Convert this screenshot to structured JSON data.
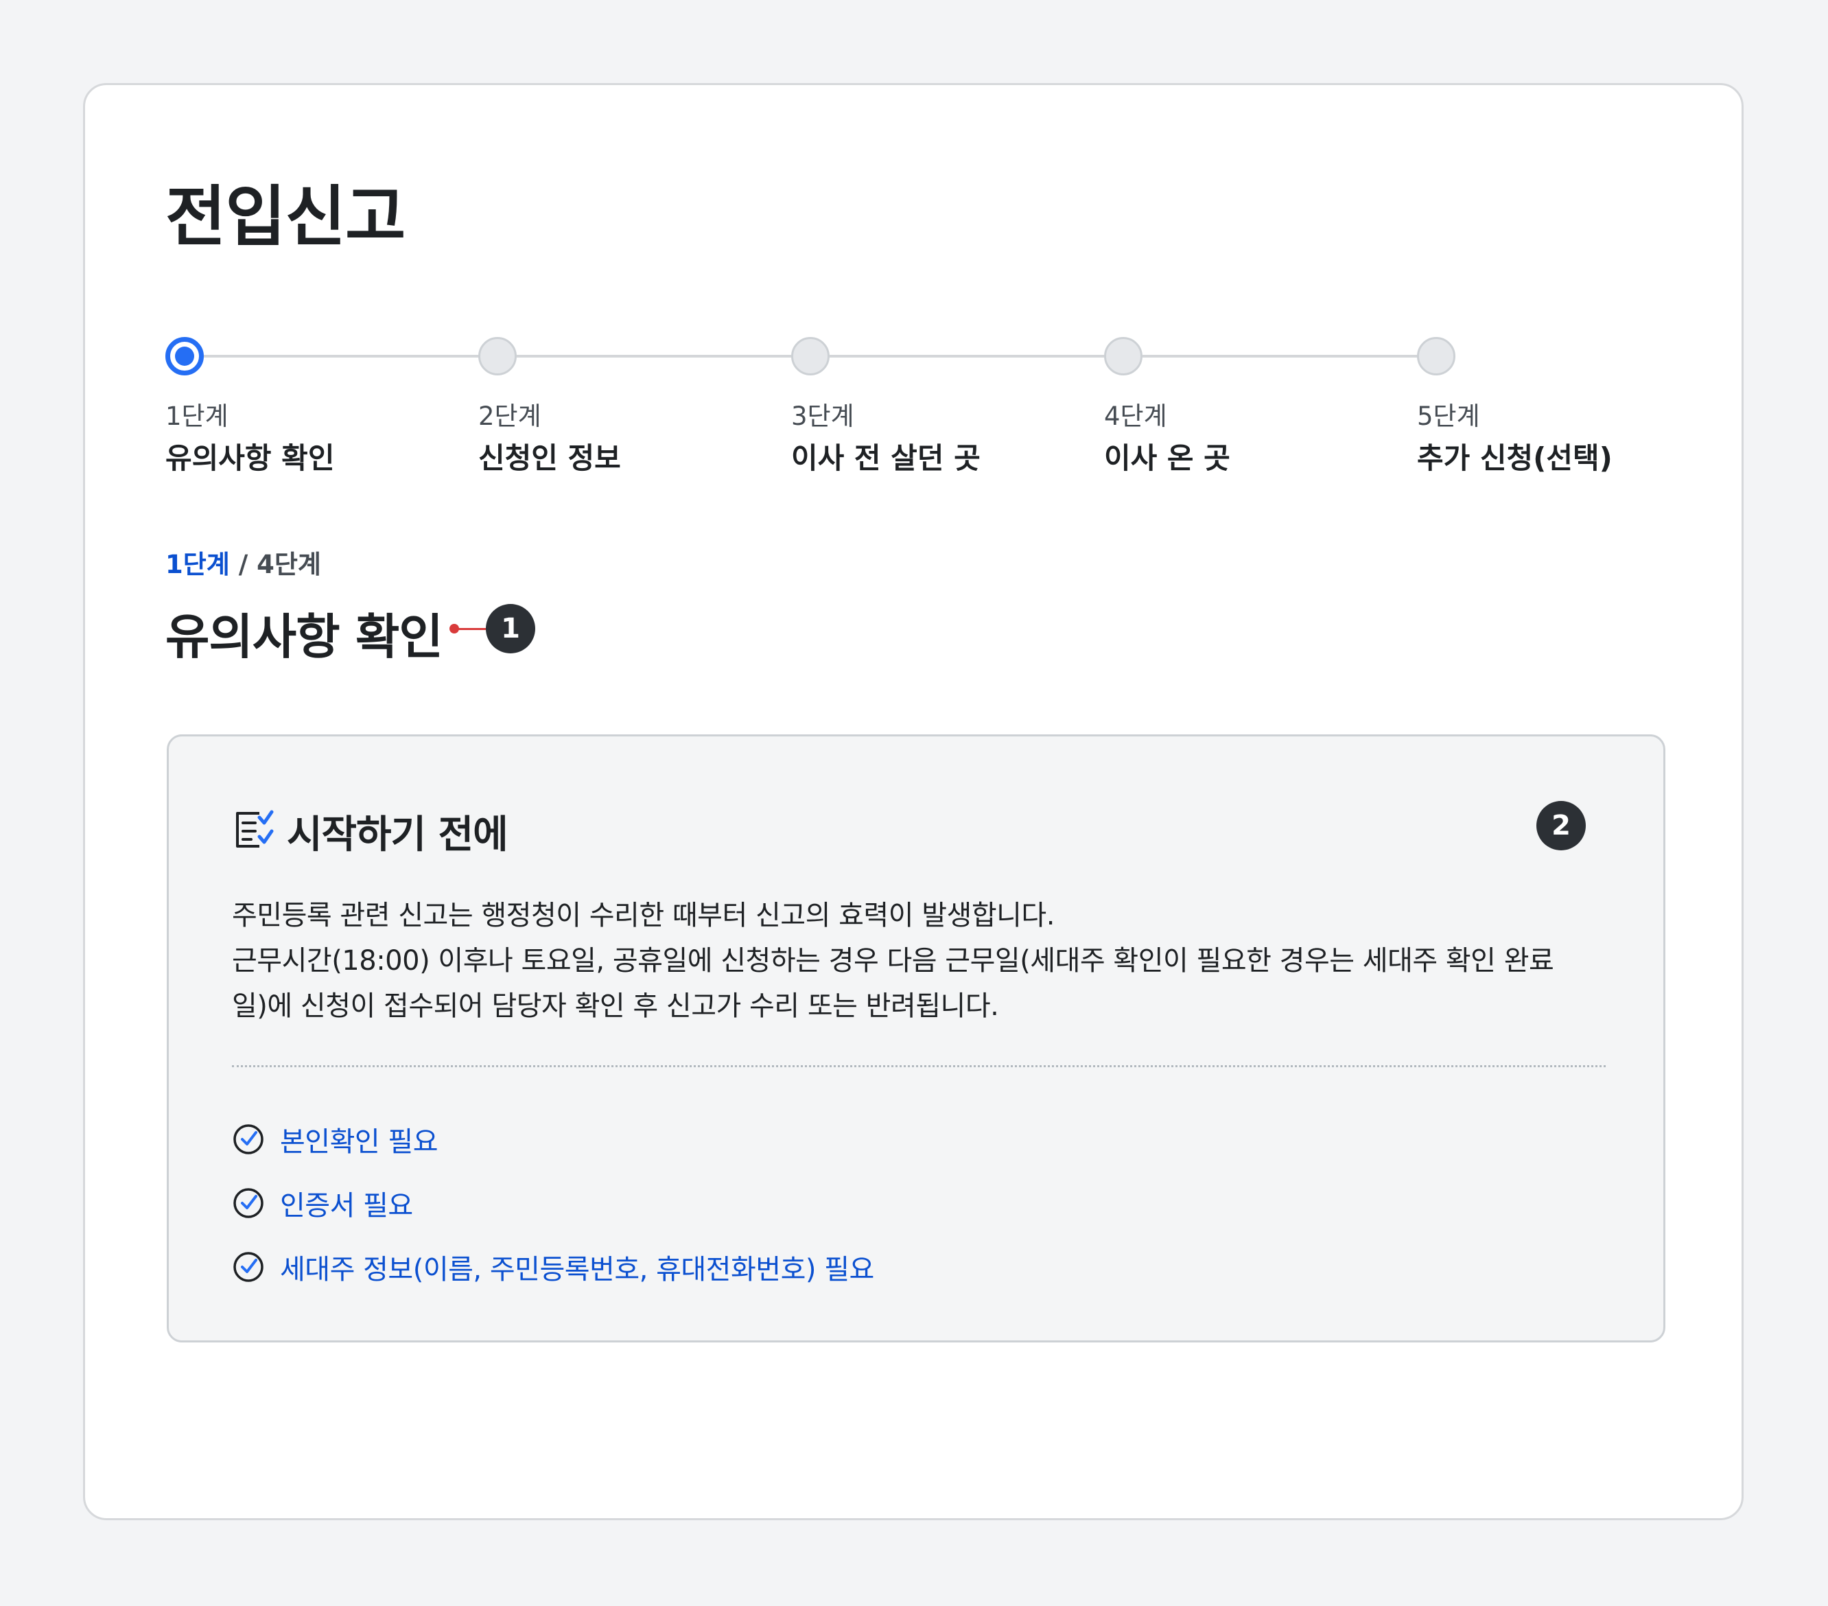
{
  "page": {
    "title": "전입신고"
  },
  "stepper": {
    "steps": [
      {
        "number": "1단계",
        "name": "유의사항 확인",
        "state": "active"
      },
      {
        "number": "2단계",
        "name": "신청인 정보",
        "state": "inactive"
      },
      {
        "number": "3단계",
        "name": "이사 전 살던 곳",
        "state": "inactive"
      },
      {
        "number": "4단계",
        "name": "이사 온 곳",
        "state": "inactive"
      },
      {
        "number": "5단계",
        "name": "추가 신청(선택)",
        "state": "inactive"
      }
    ]
  },
  "progress": {
    "current": "1단계",
    "separator": " / ",
    "total": "4단계"
  },
  "section": {
    "title": "유의사항 확인",
    "marker_badge": "1"
  },
  "info_box": {
    "title": "시작하기 전에",
    "icon": "checklist-icon",
    "marker_badge": "2",
    "body_lines": [
      "주민등록 관련 신고는 행정청이 수리한 때부터 신고의 효력이 발생합니다.",
      "근무시간(18:00) 이후나 토요일, 공휴일에 신청하는 경우 다음 근무일(세대주 확인이 필요한 경우는 세대주 확인 완료",
      "일)에 신청이 접수되어 담당자 확인 후 신고가 수리 또는 반려됩니다."
    ],
    "requirements": [
      {
        "label": "본인확인 필요",
        "icon": "check-circle-icon"
      },
      {
        "label": "인증서 필요",
        "icon": "check-circle-icon"
      },
      {
        "label": "세대주 정보(이름, 주민등록번호, 휴대전화번호) 필요",
        "icon": "check-circle-icon"
      }
    ]
  },
  "colors": {
    "accent": "#256ef4",
    "link": "#0b50d0",
    "marker": "#d93b3b",
    "badge": "#2c3035"
  }
}
